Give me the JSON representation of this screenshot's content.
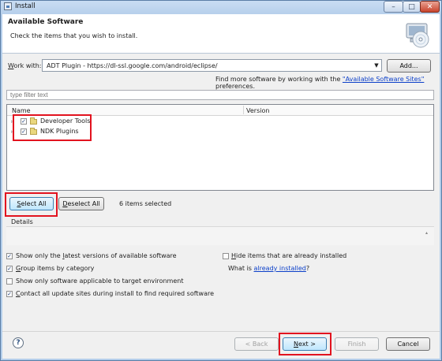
{
  "window": {
    "title": "Install",
    "minimize_glyph": "–",
    "maximize_glyph": "□",
    "close_glyph": "✕"
  },
  "header": {
    "title": "Available Software",
    "subtitle": "Check the items that you wish to install."
  },
  "work_with": {
    "label_prefix": "W",
    "label_rest": "ork with:",
    "value": "ADT Plugin - https://dl-ssl.google.com/android/eclipse/",
    "add_label": "Add..."
  },
  "find_more": {
    "prefix": "Find more software by working with the ",
    "link": "\"Available Software Sites\"",
    "suffix": " preferences."
  },
  "filter": {
    "placeholder": "type filter text"
  },
  "tree": {
    "columns": [
      "Name",
      "Version"
    ],
    "items": [
      {
        "label": "Developer Tools",
        "checked": true
      },
      {
        "label": "NDK Plugins",
        "checked": true
      }
    ]
  },
  "selection": {
    "select_all": "Select All",
    "deselect_all": "Deselect All",
    "count_text": "6 items selected"
  },
  "details": {
    "label": "Details"
  },
  "options": {
    "latest_versions": {
      "pre": "Show only the ",
      "u": "l",
      "post": "atest versions of available software",
      "checked": true
    },
    "group_by_category": {
      "pre": "",
      "u": "G",
      "post": "roup items by category",
      "checked": true
    },
    "target_env": {
      "pre": "Show only software applicable to target environment",
      "checked": false
    },
    "contact_sites": {
      "pre": "",
      "u": "C",
      "post": "ontact all update sites during install to find required software",
      "checked": true
    },
    "hide_installed": {
      "pre": "",
      "u": "H",
      "post": "ide items that are already installed",
      "checked": false
    },
    "what_is": {
      "pre": "What is ",
      "link": "already installed",
      "post": "?"
    }
  },
  "footer": {
    "help_glyph": "?",
    "back": "< Back",
    "next": "Next >",
    "finish": "Finish",
    "cancel": "Cancel"
  },
  "colors": {
    "highlight_box": "#e2131f",
    "link": "#0b3fc9",
    "title_bar": "#b3cdea"
  },
  "icons": [
    "app-icon",
    "install-cd-icon",
    "combo-arrow-icon",
    "folder-icon",
    "help-icon"
  ]
}
